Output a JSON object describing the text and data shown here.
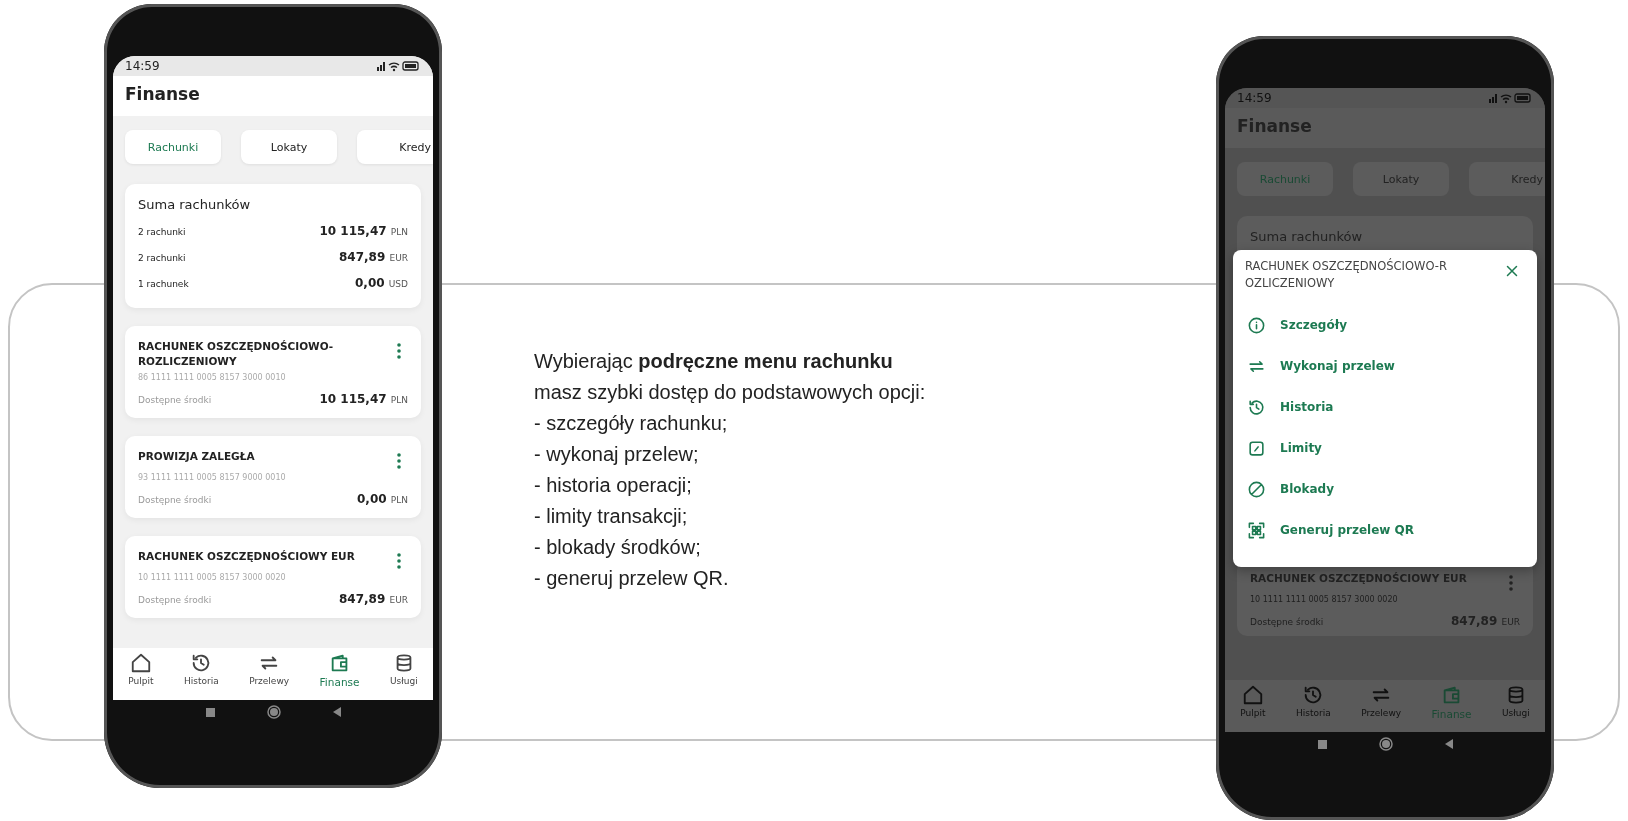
{
  "phones": [
    {
      "dimmed": false,
      "time": "14:59",
      "title": "Finanse",
      "tabs": [
        {
          "label": "Rachunki",
          "selected": true
        },
        {
          "label": "Lokaty",
          "selected": false
        },
        {
          "label": "Kredy",
          "selected": false
        }
      ],
      "summary": {
        "title": "Suma rachunków",
        "rows": [
          {
            "label": "2 rachunki",
            "amount": "10 115,47",
            "currency": "PLN"
          },
          {
            "label": "2 rachunki",
            "amount": "847,89",
            "currency": "EUR"
          },
          {
            "label": "1 rachunek",
            "amount": "0,00",
            "currency": "USD"
          }
        ]
      },
      "accounts": [
        {
          "name": "RACHUNEK OSZCZĘDNOŚCIOWO-ROZLICZENIOWY",
          "number": "86 1111 1111 0005 8157 3000 0010",
          "balance_label": "Dostępne środki",
          "amount": "10 115,47",
          "currency": "PLN"
        },
        {
          "name": "PROWIZJA ZALEGŁA",
          "number": "93 1111 1111 0005 8157 9000 0010",
          "balance_label": "Dostępne środki",
          "amount": "0,00",
          "currency": "PLN"
        },
        {
          "name": "RACHUNEK OSZCZĘDNOŚCIOWY EUR",
          "number": "10 1111 1111 0005 8157 3000 0020",
          "balance_label": "Dostępne środki",
          "amount": "847,89",
          "currency": "EUR"
        }
      ],
      "nav": [
        {
          "label": "Pulpit",
          "kind": "home",
          "selected": false
        },
        {
          "label": "Historia",
          "kind": "history",
          "selected": false
        },
        {
          "label": "Przelewy",
          "kind": "transfer",
          "selected": false
        },
        {
          "label": "Finanse",
          "kind": "wallet",
          "selected": true
        },
        {
          "label": "Usługi",
          "kind": "database",
          "selected": false
        }
      ]
    },
    {
      "dimmed": true,
      "time": "14:59",
      "title": "Finanse",
      "tabs": [
        {
          "label": "Rachunki",
          "selected": true
        },
        {
          "label": "Lokaty",
          "selected": false
        },
        {
          "label": "Kredy",
          "selected": false
        }
      ],
      "summary": {
        "title": "Suma rachunków"
      },
      "menu": {
        "title": "RACHUNEK OSZCZĘDNOŚCIOWO-ROZLICZENIOWY",
        "items": [
          {
            "label": "Szczegóły",
            "kind": "info"
          },
          {
            "label": "Wykonaj przelew",
            "kind": "transfer"
          },
          {
            "label": "Historia",
            "kind": "history"
          },
          {
            "label": "Limity",
            "kind": "gauge"
          },
          {
            "label": "Blokady",
            "kind": "block"
          },
          {
            "label": "Generuj przelew QR",
            "kind": "qr"
          }
        ]
      },
      "accounts": [
        {
          "name": "RACHUNEK OSZCZĘDNOŚCIOWY EUR",
          "number": "10 1111 1111 0005 8157 3000 0020",
          "balance_label": "Dostępne środki",
          "amount": "847,89",
          "currency": "EUR"
        }
      ],
      "nav": [
        {
          "label": "Pulpit",
          "kind": "home",
          "selected": false
        },
        {
          "label": "Historia",
          "kind": "history",
          "selected": false
        },
        {
          "label": "Przelewy",
          "kind": "transfer",
          "selected": false
        },
        {
          "label": "Finanse",
          "kind": "wallet",
          "selected": true
        },
        {
          "label": "Usługi",
          "kind": "database",
          "selected": false
        }
      ]
    }
  ],
  "description": {
    "lines": [
      "Wybierając **podręczne menu rachunku**",
      "masz szybki dostęp do podstawowych opcji:"
    ],
    "items": [
      "- szczegóły rachunku;",
      "- wykonaj przelew;",
      "- historia operacji;",
      "- limity transakcji;",
      "- blokady środków;",
      "- generuj przelew QR."
    ]
  }
}
